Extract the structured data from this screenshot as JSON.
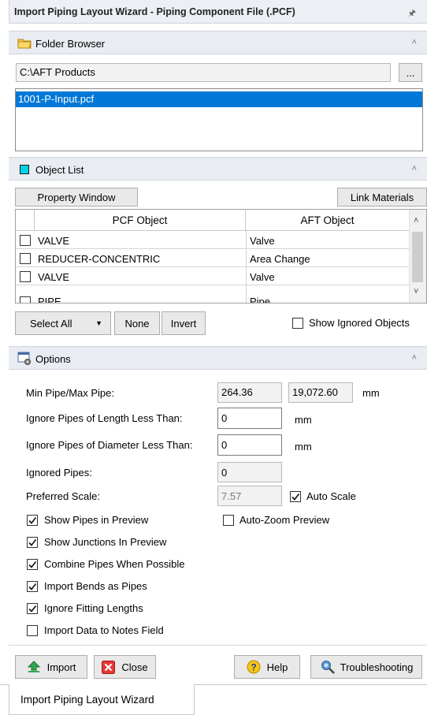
{
  "window": {
    "title": "Import Piping Layout Wizard - Piping Component File (.PCF)",
    "pin_icon": "pin-icon"
  },
  "folder_browser": {
    "header": "Folder Browser",
    "path": "C:\\AFT Products",
    "browse_label": "...",
    "files": [
      {
        "name": "1001-P-Input.pcf",
        "selected": true
      }
    ]
  },
  "object_list": {
    "header": "Object List",
    "property_window_label": "Property Window",
    "link_materials_label": "Link Materials",
    "columns": [
      "PCF Object",
      "AFT Object"
    ],
    "rows": [
      {
        "pcf": "VALVE",
        "aft": "Valve"
      },
      {
        "pcf": "REDUCER-CONCENTRIC",
        "aft": "Area Change"
      },
      {
        "pcf": "VALVE",
        "aft": "Valve"
      },
      {
        "pcf": "PIPE",
        "aft": "Pipe"
      }
    ],
    "select_all_label": "Select All",
    "none_label": "None",
    "invert_label": "Invert",
    "show_ignored_label": "Show Ignored Objects"
  },
  "options": {
    "header": "Options",
    "min_max_label": "Min Pipe/Max Pipe:",
    "min_pipe": "264.36",
    "max_pipe": "19,072.60",
    "min_max_unit": "mm",
    "ignore_length_label": "Ignore Pipes of Length Less Than:",
    "ignore_length_value": "0",
    "ignore_length_unit": "mm",
    "ignore_diameter_label": "Ignore Pipes of Diameter Less Than:",
    "ignore_diameter_value": "0",
    "ignore_diameter_unit": "mm",
    "ignored_pipes_label": "Ignored Pipes:",
    "ignored_pipes_value": "0",
    "preferred_scale_label": "Preferred Scale:",
    "preferred_scale_value": "7.57",
    "auto_scale_label": "Auto Scale",
    "auto_zoom_label": "Auto-Zoom Preview",
    "checks": [
      {
        "label": "Show Pipes in Preview",
        "checked": true
      },
      {
        "label": "Show Junctions In Preview",
        "checked": true
      },
      {
        "label": "Combine Pipes When Possible",
        "checked": true
      },
      {
        "label": "Import Bends as Pipes",
        "checked": true
      },
      {
        "label": "Ignore Fitting Lengths",
        "checked": true
      },
      {
        "label": "Import Data to Notes Field",
        "checked": false
      }
    ]
  },
  "footer": {
    "import_label": "Import",
    "close_label": "Close",
    "help_label": "Help",
    "troubleshooting_label": "Troubleshooting",
    "tab_label": "Import Piping Layout Wizard"
  },
  "colors": {
    "selection": "#0078d7",
    "object_list_icon": "#00d2e6"
  }
}
